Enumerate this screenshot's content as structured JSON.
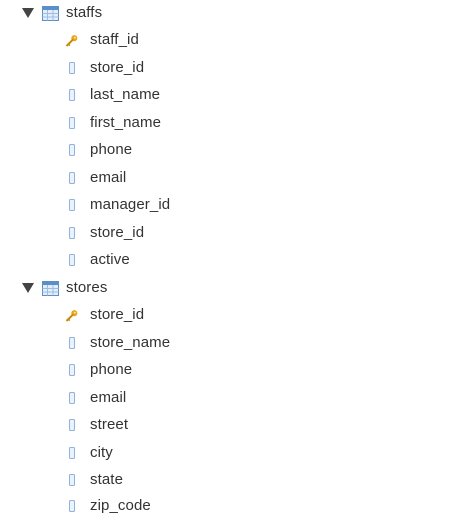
{
  "tables": [
    {
      "name": "staffs",
      "expanded": true,
      "columns": [
        {
          "name": "staff_id",
          "key": true
        },
        {
          "name": "store_id",
          "key": false
        },
        {
          "name": "last_name",
          "key": false
        },
        {
          "name": "first_name",
          "key": false
        },
        {
          "name": "phone",
          "key": false
        },
        {
          "name": "email",
          "key": false
        },
        {
          "name": "manager_id",
          "key": false
        },
        {
          "name": "store_id",
          "key": false
        },
        {
          "name": "active",
          "key": false
        }
      ]
    },
    {
      "name": "stores",
      "expanded": true,
      "columns": [
        {
          "name": "store_id",
          "key": true
        },
        {
          "name": "store_name",
          "key": false
        },
        {
          "name": "phone",
          "key": false
        },
        {
          "name": "email",
          "key": false
        },
        {
          "name": "street",
          "key": false
        },
        {
          "name": "city",
          "key": false
        },
        {
          "name": "state",
          "key": false
        },
        {
          "name": "zip_code",
          "key": false
        }
      ]
    }
  ],
  "icons": {
    "expand": "triangle-down-icon",
    "table": "table-icon",
    "primary_key": "key-icon",
    "column": "column-icon"
  },
  "colors": {
    "text": "#333333",
    "table_icon_border": "#5b8fc7",
    "table_icon_fill": "#e3eefa",
    "key_icon": "#e6a817",
    "column_icon": "#8fb3db",
    "toggle": "#444444"
  }
}
